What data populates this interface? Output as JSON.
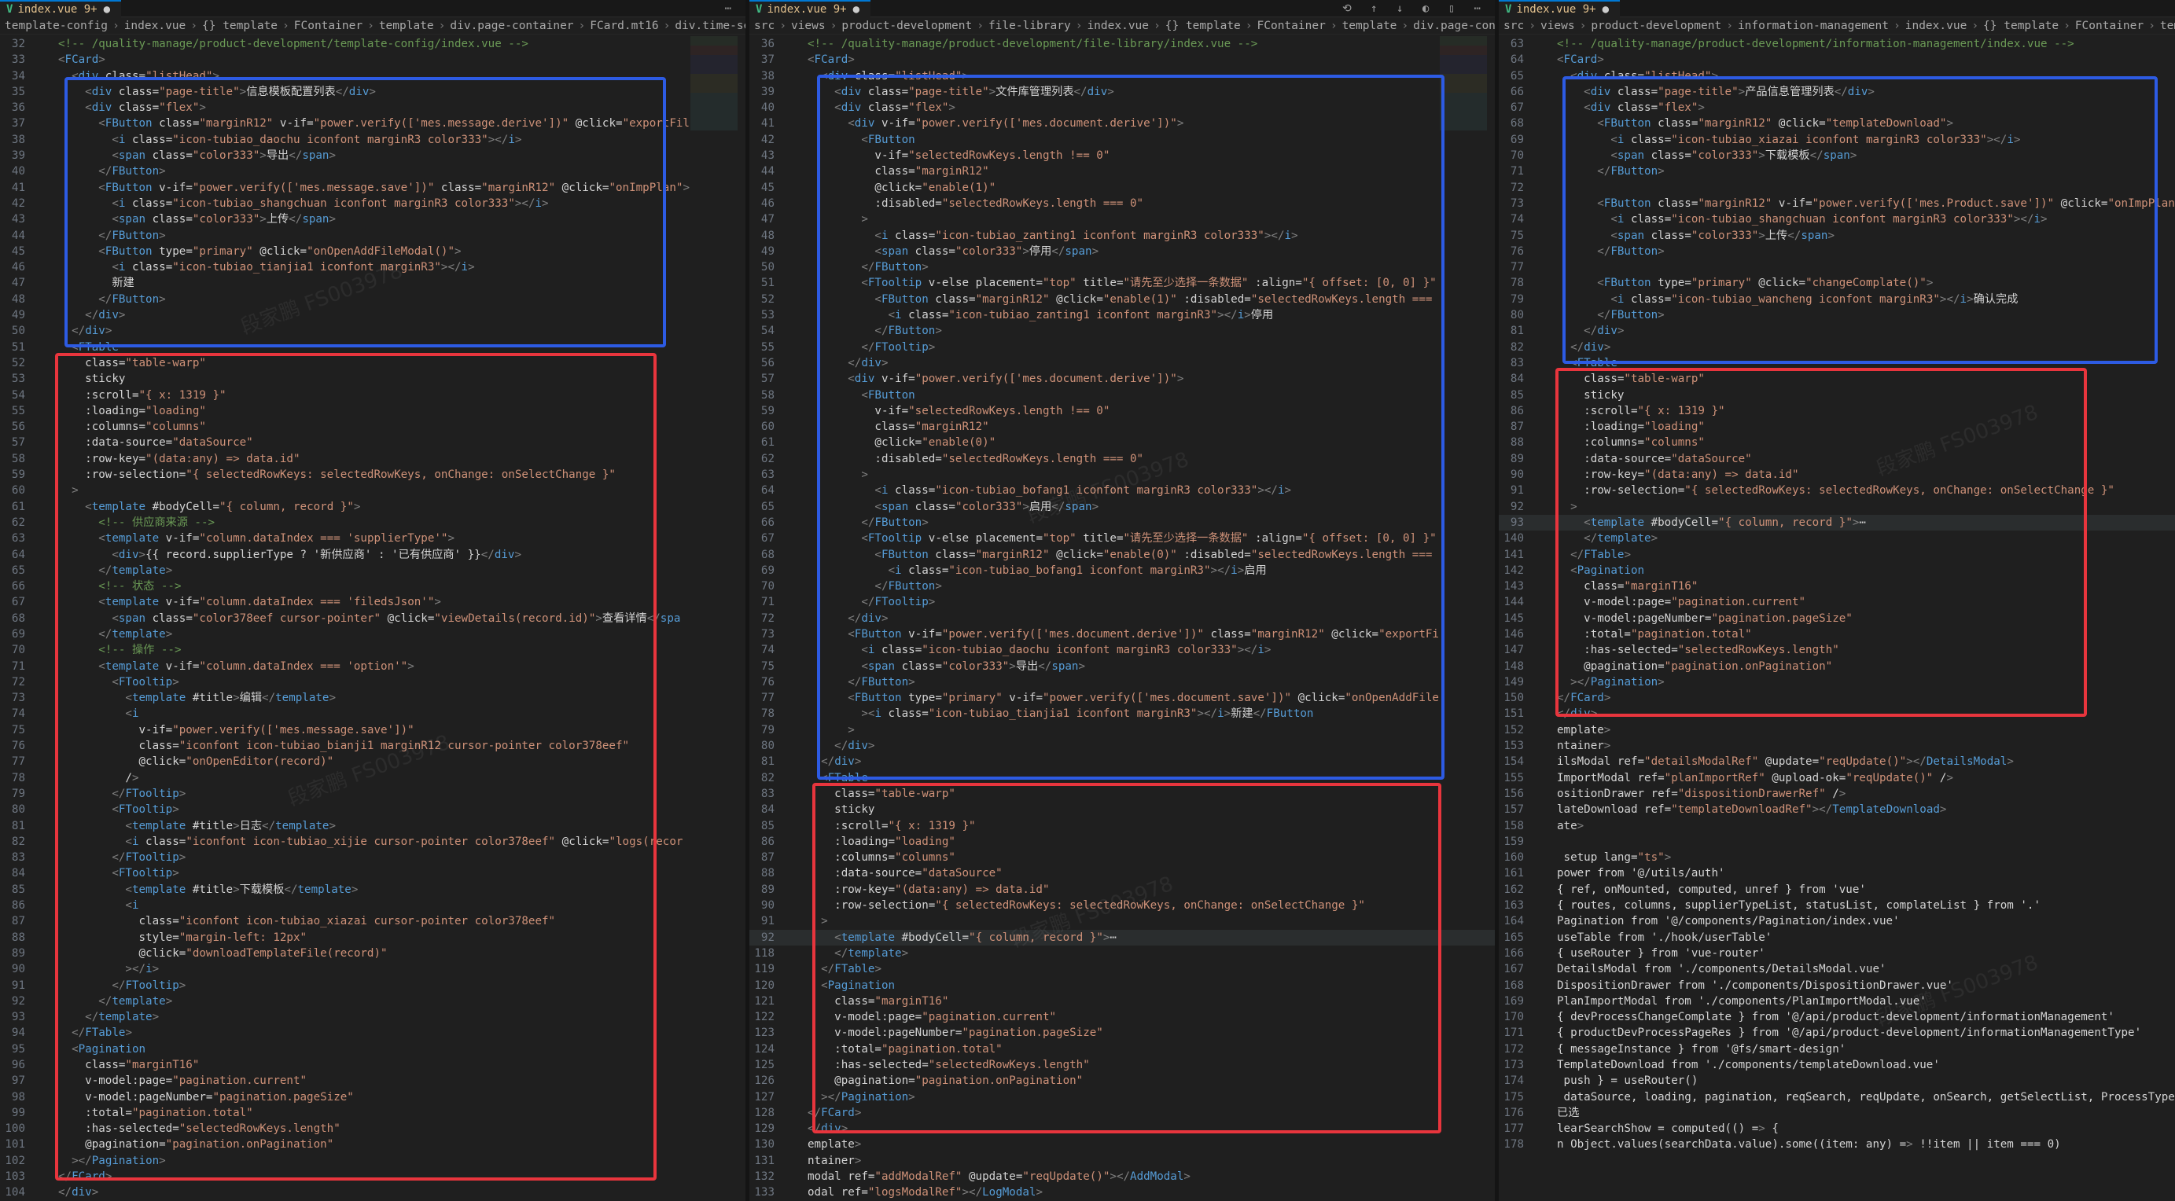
{
  "tabs": [
    {
      "vue": "V",
      "label": "index.vue 9+",
      "dot": "●"
    },
    {
      "vue": "V",
      "label": "index.vue 9+",
      "dot": "●"
    },
    {
      "vue": "V",
      "label": "index.vue 9+",
      "dot": "●"
    }
  ],
  "breadcrumbs": [
    [
      "template-config",
      "index.vue",
      "{} template",
      "FContainer",
      "template",
      "div.page-container",
      "FCard.mt16",
      "div.time-searc"
    ],
    [
      "src",
      "views",
      "product-development",
      "file-library",
      "index.vue",
      "{} template",
      "FContainer",
      "template",
      "div.page-container"
    ],
    [
      "src",
      "views",
      "product-development",
      "information-management",
      "index.vue",
      "{} template",
      "FContainer",
      "templat"
    ]
  ],
  "watermark": "段家鹏 FS003978",
  "colors": {
    "blue_box": "#2d5be3",
    "red_box": "#e8353d",
    "tag": "#569cd6",
    "attr": "#9cdcfe",
    "string": "#ce9178",
    "comment": "#6a9955"
  },
  "panes": [
    {
      "lines": [
        [
          "32",
          "<!-- /quality-manage/product-development/template-config/index.vue -->"
        ],
        [
          "33",
          "<FCard>"
        ],
        [
          "34",
          "  <div class=\"listHead\">"
        ],
        [
          "35",
          "    <div class=\"page-title\">信息模板配置列表</div>"
        ],
        [
          "36",
          "    <div class=\"flex\">"
        ],
        [
          "37",
          "      <FButton class=\"marginR12\" v-if=\"power.verify(['mes.message.derive'])\" @click=\"exportFil"
        ],
        [
          "38",
          "        <i class=\"icon-tubiao_daochu iconfont marginR3 color333\"></i>"
        ],
        [
          "39",
          "        <span class=\"color333\">导出</span>"
        ],
        [
          "40",
          "      </FButton>"
        ],
        [
          "41",
          "      <FButton v-if=\"power.verify(['mes.message.save'])\" class=\"marginR12\" @click=\"onImpPlan\">"
        ],
        [
          "42",
          "        <i class=\"icon-tubiao_shangchuan iconfont marginR3 color333\"></i>"
        ],
        [
          "43",
          "        <span class=\"color333\">上传</span>"
        ],
        [
          "44",
          "      </FButton>"
        ],
        [
          "45",
          "      <FButton type=\"primary\" @click=\"onOpenAddFileModal()\">"
        ],
        [
          "46",
          "        <i class=\"icon-tubiao_tianjia1 iconfont marginR3\"></i>"
        ],
        [
          "47",
          "        新建"
        ],
        [
          "48",
          "      </FButton>"
        ],
        [
          "49",
          "    </div>"
        ],
        [
          "50",
          "  </div>"
        ],
        [
          "51",
          "  <FTable"
        ],
        [
          "52",
          "    class=\"table-warp\""
        ],
        [
          "53",
          "    sticky"
        ],
        [
          "54",
          "    :scroll=\"{ x: 1319 }\""
        ],
        [
          "55",
          "    :loading=\"loading\""
        ],
        [
          "56",
          "    :columns=\"columns\""
        ],
        [
          "57",
          "    :data-source=\"dataSource\""
        ],
        [
          "58",
          "    :row-key=\"(data:any) => data.id\""
        ],
        [
          "59",
          "    :row-selection=\"{ selectedRowKeys: selectedRowKeys, onChange: onSelectChange }\""
        ],
        [
          "60",
          "  >"
        ],
        [
          "61",
          "    <template #bodyCell=\"{ column, record }\">"
        ],
        [
          "62",
          "      <!-- 供应商来源 -->"
        ],
        [
          "63",
          "      <template v-if=\"column.dataIndex === 'supplierType'\">"
        ],
        [
          "64",
          "        <div>{{ record.supplierType ? '新供应商' : '已有供应商' }}</div>"
        ],
        [
          "65",
          "      </template>"
        ],
        [
          "66",
          "      <!-- 状态 -->"
        ],
        [
          "67",
          "      <template v-if=\"column.dataIndex === 'filedsJson'\">"
        ],
        [
          "68",
          "        <span class=\"color378eef cursor-pointer\" @click=\"viewDetails(record.id)\">查看详情</spa"
        ],
        [
          "69",
          "      </template>"
        ],
        [
          "70",
          "      <!-- 操作 -->"
        ],
        [
          "71",
          "      <template v-if=\"column.dataIndex === 'option'\">"
        ],
        [
          "72",
          "        <FTooltip>"
        ],
        [
          "73",
          "          <template #title>编辑</template>"
        ],
        [
          "74",
          "          <i"
        ],
        [
          "75",
          "            v-if=\"power.verify(['mes.message.save'])\""
        ],
        [
          "76",
          "            class=\"iconfont icon-tubiao_bianji1 marginR12 cursor-pointer color378eef\""
        ],
        [
          "77",
          "            @click=\"onOpenEditor(record)\""
        ],
        [
          "78",
          "          />"
        ],
        [
          "79",
          "        </FTooltip>"
        ],
        [
          "80",
          "        <FTooltip>"
        ],
        [
          "81",
          "          <template #title>日志</template>"
        ],
        [
          "82",
          "          <i class=\"iconfont icon-tubiao_xijie cursor-pointer color378eef\" @click=\"logs(recor"
        ],
        [
          "83",
          "        </FTooltip>"
        ],
        [
          "84",
          "        <FTooltip>"
        ],
        [
          "85",
          "          <template #title>下载模板</template>"
        ],
        [
          "86",
          "          <i"
        ],
        [
          "87",
          "            class=\"iconfont icon-tubiao_xiazai cursor-pointer color378eef\""
        ],
        [
          "88",
          "            style=\"margin-left: 12px\""
        ],
        [
          "89",
          "            @click=\"downloadTemplateFile(record)\""
        ],
        [
          "90",
          "          ></i>"
        ],
        [
          "91",
          "        </FTooltip>"
        ],
        [
          "92",
          "      </template>"
        ],
        [
          "93",
          "    </template>"
        ],
        [
          "94",
          "  </FTable>"
        ],
        [
          "95",
          "  <Pagination"
        ],
        [
          "96",
          "    class=\"marginT16\""
        ],
        [
          "97",
          "    v-model:page=\"pagination.current\""
        ],
        [
          "98",
          "    v-model:pageNumber=\"pagination.pageSize\""
        ],
        [
          "99",
          "    :total=\"pagination.total\""
        ],
        [
          "100",
          "    :has-selected=\"selectedRowKeys.length\""
        ],
        [
          "101",
          "    @pagination=\"pagination.onPagination\""
        ],
        [
          "102",
          "  ></Pagination>"
        ],
        [
          "103",
          "</FCard>"
        ],
        [
          "104",
          "</div>"
        ]
      ]
    },
    {
      "lines": [
        [
          "36",
          "<!-- /quality-manage/product-development/file-library/index.vue -->"
        ],
        [
          "37",
          "<FCard>"
        ],
        [
          "38",
          "  <div class=\"listHead\">"
        ],
        [
          "39",
          "    <div class=\"page-title\">文件库管理列表</div>"
        ],
        [
          "40",
          "    <div class=\"flex\">"
        ],
        [
          "41",
          "      <div v-if=\"power.verify(['mes.document.derive'])\">"
        ],
        [
          "42",
          "        <FButton"
        ],
        [
          "43",
          "          v-if=\"selectedRowKeys.length !== 0\""
        ],
        [
          "44",
          "          class=\"marginR12\""
        ],
        [
          "45",
          "          @click=\"enable(1)\""
        ],
        [
          "46",
          "          :disabled=\"selectedRowKeys.length === 0\""
        ],
        [
          "47",
          "        >"
        ],
        [
          "48",
          "          <i class=\"icon-tubiao_zanting1 iconfont marginR3 color333\"></i>"
        ],
        [
          "49",
          "          <span class=\"color333\">停用</span>"
        ],
        [
          "50",
          "        </FButton>"
        ],
        [
          "51",
          "        <FTooltip v-else placement=\"top\" title=\"请先至少选择一条数据\" :align=\"{ offset: [0, 0] }\""
        ],
        [
          "52",
          "          <FButton class=\"marginR12\" @click=\"enable(1)\" :disabled=\"selectedRowKeys.length ==="
        ],
        [
          "53",
          "            <i class=\"icon-tubiao_zanting1 iconfont marginR3\"></i>停用"
        ],
        [
          "54",
          "          </FButton>"
        ],
        [
          "55",
          "        </FTooltip>"
        ],
        [
          "56",
          "      </div>"
        ],
        [
          "57",
          "      <div v-if=\"power.verify(['mes.document.derive'])\">"
        ],
        [
          "58",
          "        <FButton"
        ],
        [
          "59",
          "          v-if=\"selectedRowKeys.length !== 0\""
        ],
        [
          "60",
          "          class=\"marginR12\""
        ],
        [
          "61",
          "          @click=\"enable(0)\""
        ],
        [
          "62",
          "          :disabled=\"selectedRowKeys.length === 0\""
        ],
        [
          "63",
          "        >"
        ],
        [
          "64",
          "          <i class=\"icon-tubiao_bofang1 iconfont marginR3 color333\"></i>"
        ],
        [
          "65",
          "          <span class=\"color333\">启用</span>"
        ],
        [
          "66",
          "        </FButton>"
        ],
        [
          "67",
          "        <FTooltip v-else placement=\"top\" title=\"请先至少选择一条数据\" :align=\"{ offset: [0, 0] }\""
        ],
        [
          "68",
          "          <FButton class=\"marginR12\" @click=\"enable(0)\" :disabled=\"selectedRowKeys.length ==="
        ],
        [
          "69",
          "            <i class=\"icon-tubiao_bofang1 iconfont marginR3\"></i>启用"
        ],
        [
          "70",
          "          </FButton>"
        ],
        [
          "71",
          "        </FTooltip>"
        ],
        [
          "72",
          "      </div>"
        ],
        [
          "73",
          "      <FButton v-if=\"power.verify(['mes.document.derive'])\" class=\"marginR12\" @click=\"exportFi"
        ],
        [
          "74",
          "        <i class=\"icon-tubiao_daochu iconfont marginR3 color333\"></i>"
        ],
        [
          "75",
          "        <span class=\"color333\">导出</span>"
        ],
        [
          "76",
          "      </FButton>"
        ],
        [
          "77",
          "      <FButton type=\"primary\" v-if=\"power.verify(['mes.document.save'])\" @click=\"onOpenAddFile"
        ],
        [
          "78",
          "        ><i class=\"icon-tubiao_tianjia1 iconfont marginR3\"></i>新建</FButton"
        ],
        [
          "79",
          "      >"
        ],
        [
          "80",
          "    </div>"
        ],
        [
          "81",
          "  </div>"
        ],
        [
          "82",
          "  <FTable"
        ],
        [
          "83",
          "    class=\"table-warp\""
        ],
        [
          "84",
          "    sticky"
        ],
        [
          "85",
          "    :scroll=\"{ x: 1319 }\""
        ],
        [
          "86",
          "    :loading=\"loading\""
        ],
        [
          "87",
          "    :columns=\"columns\""
        ],
        [
          "88",
          "    :data-source=\"dataSource\""
        ],
        [
          "89",
          "    :row-key=\"(data:any) => data.id\""
        ],
        [
          "90",
          "    :row-selection=\"{ selectedRowKeys: selectedRowKeys, onChange: onSelectChange }\""
        ],
        [
          "91",
          "  >"
        ],
        [
          "92",
          "    <template #bodyCell=\"{ column, record }\">⋯"
        ],
        [
          "118",
          "    </template>"
        ],
        [
          "119",
          "  </FTable>"
        ],
        [
          "120",
          "  <Pagination"
        ],
        [
          "121",
          "    class=\"marginT16\""
        ],
        [
          "122",
          "    v-model:page=\"pagination.current\""
        ],
        [
          "123",
          "    v-model:pageNumber=\"pagination.pageSize\""
        ],
        [
          "124",
          "    :total=\"pagination.total\""
        ],
        [
          "125",
          "    :has-selected=\"selectedRowKeys.length\""
        ],
        [
          "126",
          "    @pagination=\"pagination.onPagination\""
        ],
        [
          "127",
          "  ></Pagination>"
        ],
        [
          "128",
          "</FCard>"
        ],
        [
          "129",
          "</div>"
        ],
        [
          "130",
          "emplate>"
        ],
        [
          "131",
          "ntainer>"
        ],
        [
          "132",
          "modal ref=\"addModalRef\" @update=\"reqUpdate()\"></AddModal>"
        ],
        [
          "133",
          "odal ref=\"logsModalRef\"></LogModal>"
        ]
      ]
    },
    {
      "lines": [
        [
          "63",
          "<!-- /quality-manage/product-development/information-management/index.vue -->"
        ],
        [
          "64",
          "<FCard>"
        ],
        [
          "65",
          "  <div class=\"listHead\">"
        ],
        [
          "66",
          "    <div class=\"page-title\">产品信息管理列表</div>"
        ],
        [
          "67",
          "    <div class=\"flex\">"
        ],
        [
          "68",
          "      <FButton class=\"marginR12\" @click=\"templateDownload\">"
        ],
        [
          "69",
          "        <i class=\"icon-tubiao_xiazai iconfont marginR3 color333\"></i>"
        ],
        [
          "70",
          "        <span class=\"color333\">下载模板</span>"
        ],
        [
          "71",
          "      </FButton>"
        ],
        [
          "72",
          ""
        ],
        [
          "73",
          "      <FButton class=\"marginR12\" v-if=\"power.verify(['mes.Product.save'])\" @click=\"onImpPlan\">"
        ],
        [
          "74",
          "        <i class=\"icon-tubiao_shangchuan iconfont marginR3 color333\"></i>"
        ],
        [
          "75",
          "        <span class=\"color333\">上传</span>"
        ],
        [
          "76",
          "      </FButton>"
        ],
        [
          "77",
          ""
        ],
        [
          "78",
          "      <FButton type=\"primary\" @click=\"changeComplate()\">"
        ],
        [
          "79",
          "        <i class=\"icon-tubiao_wancheng iconfont marginR3\"></i>确认完成"
        ],
        [
          "80",
          "      </FButton>"
        ],
        [
          "81",
          "    </div>"
        ],
        [
          "82",
          "  </div>"
        ],
        [
          "83",
          "  <FTable"
        ],
        [
          "84",
          "    class=\"table-warp\""
        ],
        [
          "85",
          "    sticky"
        ],
        [
          "86",
          "    :scroll=\"{ x: 1319 }\""
        ],
        [
          "87",
          "    :loading=\"loading\""
        ],
        [
          "88",
          "    :columns=\"columns\""
        ],
        [
          "89",
          "    :data-source=\"dataSource\""
        ],
        [
          "90",
          "    :row-key=\"(data:any) => data.id\""
        ],
        [
          "91",
          "    :row-selection=\"{ selectedRowKeys: selectedRowKeys, onChange: onSelectChange }\""
        ],
        [
          "92",
          "  >"
        ],
        [
          "93",
          "    <template #bodyCell=\"{ column, record }\">⋯"
        ],
        [
          "140",
          "    </template>"
        ],
        [
          "141",
          "  </FTable>"
        ],
        [
          "142",
          "  <Pagination"
        ],
        [
          "143",
          "    class=\"marginT16\""
        ],
        [
          "144",
          "    v-model:page=\"pagination.current\""
        ],
        [
          "145",
          "    v-model:pageNumber=\"pagination.pageSize\""
        ],
        [
          "146",
          "    :total=\"pagination.total\""
        ],
        [
          "147",
          "    :has-selected=\"selectedRowKeys.length\""
        ],
        [
          "148",
          "    @pagination=\"pagination.onPagination\""
        ],
        [
          "149",
          "  ></Pagination>"
        ],
        [
          "150",
          "</FCard>"
        ],
        [
          "151",
          "</div>"
        ],
        [
          "152",
          "emplate>"
        ],
        [
          "153",
          "ntainer>"
        ],
        [
          "154",
          "ilsModal ref=\"detailsModalRef\" @update=\"reqUpdate()\"></DetailsModal>"
        ],
        [
          "155",
          "ImportModal ref=\"planImportRef\" @upload-ok=\"reqUpdate()\" />"
        ],
        [
          "156",
          "ositionDrawer ref=\"dispositionDrawerRef\" />"
        ],
        [
          "157",
          "lateDownload ref=\"templateDownloadRef\"></TemplateDownload>"
        ],
        [
          "158",
          "ate>"
        ],
        [
          "159",
          ""
        ],
        [
          "160",
          " setup lang=\"ts\">"
        ],
        [
          "161",
          "power from '@/utils/auth'"
        ],
        [
          "162",
          "{ ref, onMounted, computed, unref } from 'vue'"
        ],
        [
          "163",
          "{ routes, columns, supplierTypeList, statusList, complateList } from '.'"
        ],
        [
          "164",
          "Pagination from '@/components/Pagination/index.vue'"
        ],
        [
          "165",
          "useTable from './hook/userTable'"
        ],
        [
          "166",
          "{ useRouter } from 'vue-router'"
        ],
        [
          "167",
          "DetailsModal from './components/DetailsModal.vue'"
        ],
        [
          "168",
          "DispositionDrawer from './components/DispositionDrawer.vue'"
        ],
        [
          "169",
          "PlanImportModal from './components/PlanImportModal.vue'"
        ],
        [
          "170",
          "{ devProcessChangeComplate } from '@/api/product-development/informationManagement'"
        ],
        [
          "171",
          "{ productDevProcessPageRes } from '@/api/product-development/informationManagementType'"
        ],
        [
          "172",
          "{ messageInstance } from '@fs/smart-design'"
        ],
        [
          "173",
          "TemplateDownload from './components/templateDownload.vue'"
        ],
        [
          "174",
          " push } = useRouter()"
        ],
        [
          "175",
          " dataSource, loading, pagination, reqSearch, reqUpdate, onSearch, getSelectList, ProcessTypeLis"
        ],
        [
          "176",
          "已选"
        ],
        [
          "177",
          "learSearchShow = computed(() => {"
        ],
        [
          "178",
          "n Object.values(searchData.value).some((item: any) => !!item || item === 0)"
        ]
      ]
    }
  ]
}
